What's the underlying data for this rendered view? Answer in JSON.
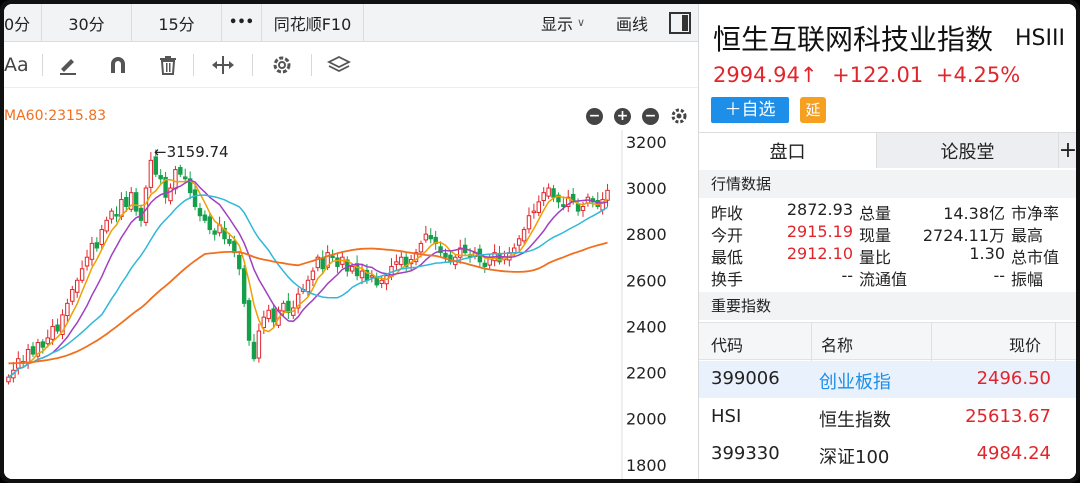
{
  "topbar": {
    "items": [
      "0分",
      "30分",
      "15分",
      "•••",
      "同花顺F10"
    ],
    "display_label": "显示",
    "draw_label": "画线"
  },
  "toolbar": {
    "font_label": "Aa"
  },
  "indicator": {
    "ma_label": "MA60:2315.83"
  },
  "colors": {
    "up": "#e0262c",
    "down": "#14a04a",
    "ma5": "#f0a000",
    "ma10": "#a040c0",
    "ma20": "#30b8d8",
    "ma60": "#f07020",
    "accent": "#1e8fe8"
  },
  "chart_data": {
    "type": "candlestick",
    "y_ticks": [
      "3200",
      "3000",
      "2800",
      "2600",
      "2400",
      "2200",
      "2000",
      "1800"
    ],
    "ylim": [
      1760,
      3230
    ],
    "high_annotation": "←3159.74",
    "high_value": 3159.74,
    "candles_shape": [
      2180,
      2210,
      2260,
      2240,
      2300,
      2280,
      2330,
      2310,
      2350,
      2400,
      2380,
      2450,
      2500,
      2560,
      2600,
      2650,
      2700,
      2760,
      2740,
      2820,
      2860,
      2900,
      2880,
      2950,
      2920,
      2980,
      2900,
      2860,
      3000,
      3120,
      3060,
      3040,
      2960,
      3000,
      3080,
      3060,
      3040,
      2980,
      2920,
      2880,
      2860,
      2820,
      2800,
      2840,
      2780,
      2760,
      2720,
      2650,
      2500,
      2340,
      2260,
      2380,
      2440,
      2470,
      2420,
      2470,
      2500,
      2460,
      2480,
      2540,
      2560,
      2600,
      2640,
      2700,
      2650,
      2720,
      2700,
      2660,
      2700,
      2640,
      2660,
      2620,
      2640,
      2600,
      2620,
      2580,
      2600,
      2620,
      2660,
      2680,
      2700,
      2660,
      2690,
      2720,
      2760,
      2800,
      2780,
      2760,
      2720,
      2700,
      2680,
      2700,
      2740,
      2720,
      2700,
      2720,
      2680,
      2660,
      2700,
      2720,
      2680,
      2700,
      2720,
      2740,
      2780,
      2820,
      2880,
      2900,
      2940,
      2980,
      3000,
      2960,
      2940,
      2920,
      2960,
      2940,
      2900,
      2920,
      2960,
      2940,
      2920,
      2950,
      2990
    ]
  },
  "header": {
    "title": "恒生互联网科技业指数",
    "code": "HSIII",
    "price": "2994.94↑",
    "change": "+122.01",
    "change_pct": "+4.25%",
    "add_button": "＋自选",
    "delay_badge": "延"
  },
  "tabs": [
    "盘口",
    "论股堂",
    "+"
  ],
  "quote": {
    "section_title": "行情数据",
    "rows": [
      {
        "l1": "昨收",
        "v1": "2872.93",
        "l2": "总量",
        "v2": "14.38亿",
        "l3": "市净率"
      },
      {
        "l1": "今开",
        "v1": "2915.19",
        "l2": "现量",
        "v2": "2724.11万",
        "l3": "最高"
      },
      {
        "l1": "最低",
        "v1": "2912.10",
        "l2": "量比",
        "v2": "1.30",
        "l3": "总市值"
      },
      {
        "l1": "换手",
        "v1": "--",
        "l2": "流通值",
        "v2": "--",
        "l3": "振幅"
      }
    ]
  },
  "indices": {
    "section_title": "重要指数",
    "headers": [
      "代码",
      "名称",
      "现价"
    ],
    "rows": [
      {
        "code": "399006",
        "name": "创业板指",
        "price": "2496.50"
      },
      {
        "code": "HSI",
        "name": "恒生指数",
        "price": "25613.67"
      },
      {
        "code": "399330",
        "name": "深证100",
        "price": "4984.24"
      }
    ]
  }
}
